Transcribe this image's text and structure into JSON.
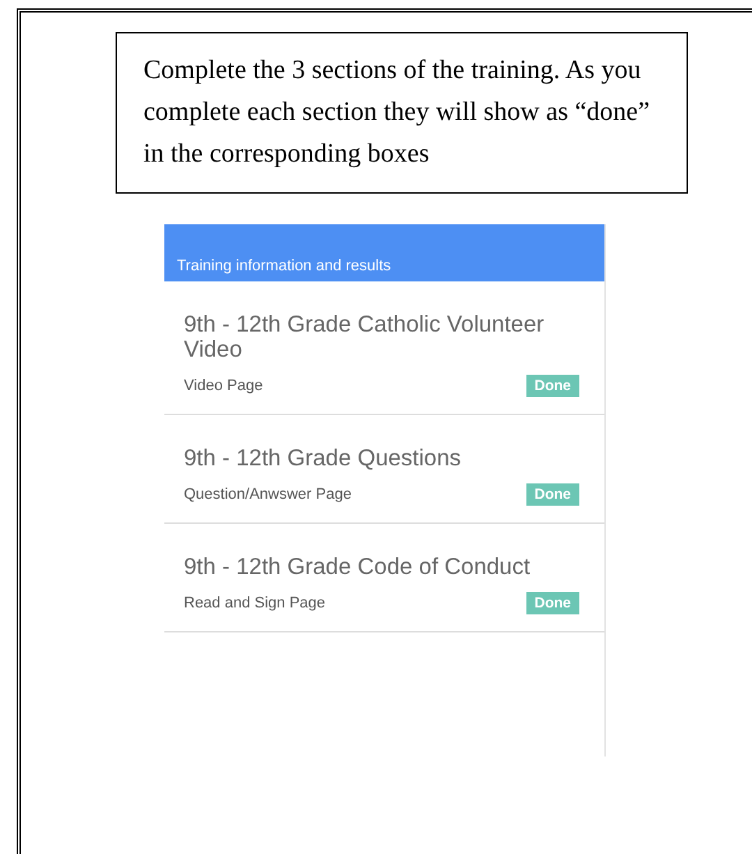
{
  "callout": {
    "text": "Complete the 3 sections of the training. As you complete each section they will show as “done” in the corresponding boxes"
  },
  "panel": {
    "subtitle": "Training information and results",
    "items": [
      {
        "title": "9th - 12th Grade Catholic Volunteer Video",
        "page_type": "Video Page",
        "status": "Done"
      },
      {
        "title": "9th - 12th Grade Questions",
        "page_type": "Question/Anwswer Page",
        "status": "Done"
      },
      {
        "title": "9th - 12th Grade Code of Conduct",
        "page_type": "Read and Sign Page",
        "status": "Done"
      }
    ]
  }
}
